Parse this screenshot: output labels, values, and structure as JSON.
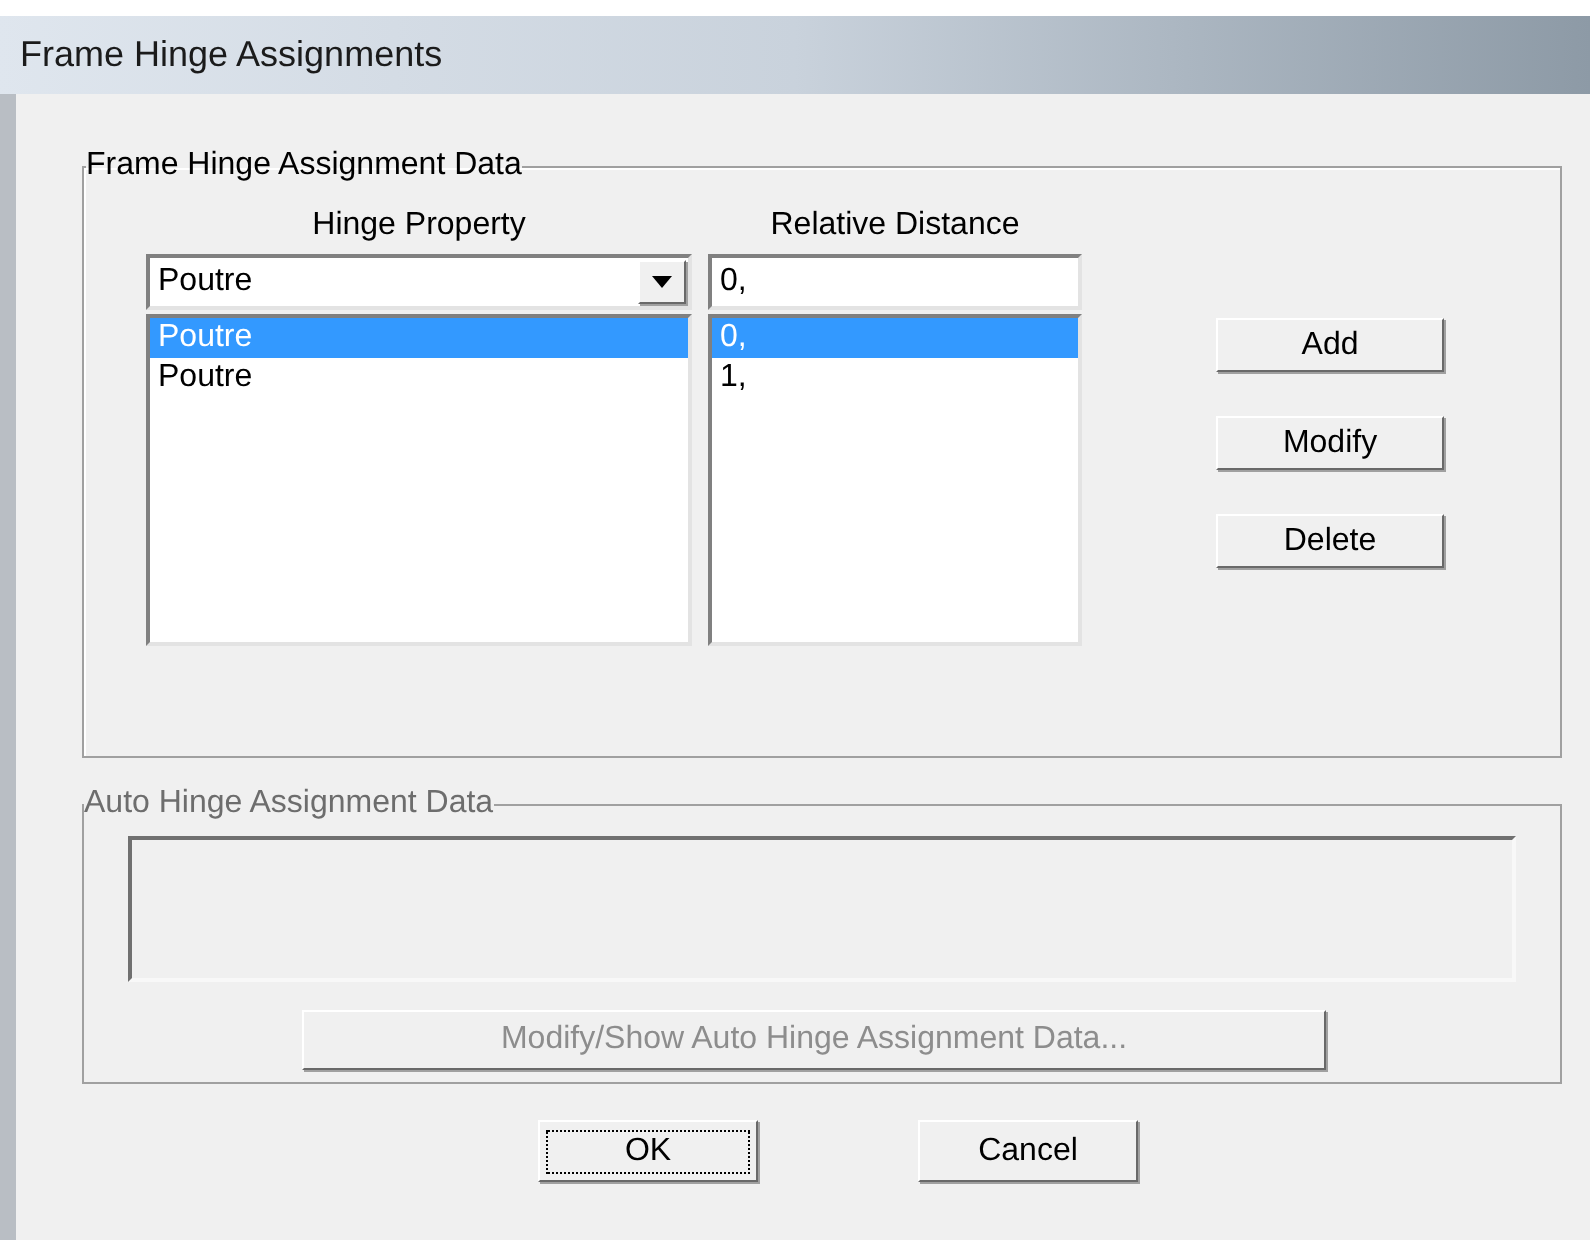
{
  "window": {
    "title": "Frame Hinge Assignments"
  },
  "hinge_group": {
    "title": "Frame Hinge Assignment Data",
    "hinge_property": {
      "label": "Hinge Property",
      "value": "Poutre"
    },
    "relative_distance": {
      "label": "Relative Distance",
      "value": "0,"
    },
    "rows": [
      {
        "property": "Poutre",
        "distance": "0,",
        "selected": true
      },
      {
        "property": "Poutre",
        "distance": "1,",
        "selected": false
      }
    ],
    "buttons": [
      "Add",
      "Modify",
      "Delete"
    ]
  },
  "auto_group": {
    "title": "Auto Hinge Assignment Data",
    "button": {
      "label": "Modify/Show Auto Hinge Assignment Data...",
      "disabled": true
    }
  },
  "buttons": [
    {
      "label": "OK",
      "focused": true
    },
    {
      "label": "Cancel",
      "focused": false
    }
  ]
}
